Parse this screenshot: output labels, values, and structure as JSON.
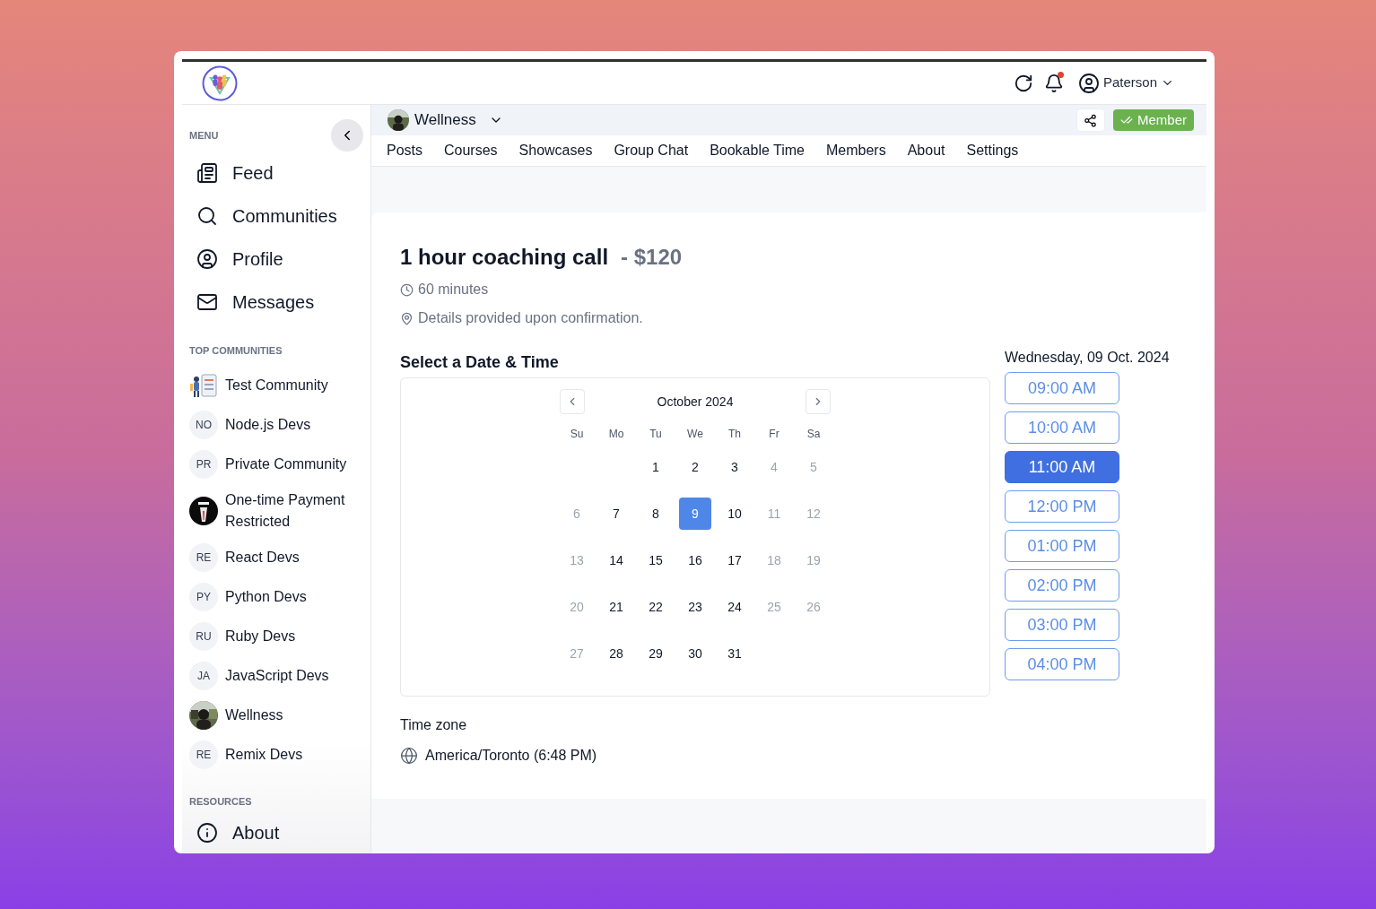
{
  "header": {
    "user": "Paterson",
    "notifications_unread": true
  },
  "sidebar": {
    "menu_label": "MENU",
    "menu": [
      {
        "label": "Feed",
        "kind": "feed"
      },
      {
        "label": "Communities",
        "kind": "search"
      },
      {
        "label": "Profile",
        "kind": "profile"
      },
      {
        "label": "Messages",
        "kind": "mail"
      }
    ],
    "communities_label": "TOP COMMUNITIES",
    "communities": [
      {
        "name": "Test Community",
        "kind": "picture"
      },
      {
        "name": "Node.js Devs",
        "initials": "NO",
        "kind": "initials"
      },
      {
        "name": "Private Community",
        "initials": "PR",
        "kind": "initials"
      },
      {
        "name": "One-time Payment Restricted",
        "kind": "picture"
      },
      {
        "name": "React Devs",
        "initials": "RE",
        "kind": "initials"
      },
      {
        "name": "Python Devs",
        "initials": "PY",
        "kind": "initials"
      },
      {
        "name": "Ruby Devs",
        "initials": "RU",
        "kind": "initials"
      },
      {
        "name": "JavaScript Devs",
        "initials": "JA",
        "kind": "initials"
      },
      {
        "name": "Wellness",
        "kind": "picture"
      },
      {
        "name": "Remix Devs",
        "initials": "RE",
        "kind": "initials"
      }
    ],
    "resources_label": "RESOURCES",
    "resources": [
      {
        "label": "About"
      }
    ]
  },
  "community": {
    "name": "Wellness",
    "member_label": "Member"
  },
  "tabs": [
    "Posts",
    "Courses",
    "Showcases",
    "Group Chat",
    "Bookable Time",
    "Members",
    "About",
    "Settings"
  ],
  "booking": {
    "title": "1 hour coaching call",
    "price": "- $120",
    "duration": "60 minutes",
    "location": "Details provided upon confirmation.",
    "select_heading": "Select a Date & Time",
    "calendar": {
      "month": "October 2024",
      "weekdays": [
        "Su",
        "Mo",
        "Tu",
        "We",
        "Th",
        "Fr",
        "Sa"
      ],
      "weeks": [
        [
          {
            "day": "1",
            "disabled": false,
            "selected": false
          },
          {
            "day": "2",
            "disabled": false,
            "selected": false
          },
          {
            "day": "3",
            "disabled": false,
            "selected": false
          },
          {
            "day": "4",
            "disabled": true,
            "selected": false
          },
          {
            "day": "5",
            "disabled": true,
            "selected": false
          }
        ],
        [
          {
            "day": "6",
            "disabled": true,
            "selected": false
          },
          {
            "day": "7",
            "disabled": false,
            "selected": false
          },
          {
            "day": "8",
            "disabled": false,
            "selected": false
          },
          {
            "day": "9",
            "disabled": false,
            "selected": true
          },
          {
            "day": "10",
            "disabled": false,
            "selected": false
          },
          {
            "day": "11",
            "disabled": true,
            "selected": false
          },
          {
            "day": "12",
            "disabled": true,
            "selected": false
          }
        ],
        [
          {
            "day": "13",
            "disabled": true,
            "selected": false
          },
          {
            "day": "14",
            "disabled": false,
            "selected": false
          },
          {
            "day": "15",
            "disabled": false,
            "selected": false
          },
          {
            "day": "16",
            "disabled": false,
            "selected": false
          },
          {
            "day": "17",
            "disabled": false,
            "selected": false
          },
          {
            "day": "18",
            "disabled": true,
            "selected": false
          },
          {
            "day": "19",
            "disabled": true,
            "selected": false
          }
        ],
        [
          {
            "day": "20",
            "disabled": true,
            "selected": false
          },
          {
            "day": "21",
            "disabled": false,
            "selected": false
          },
          {
            "day": "22",
            "disabled": false,
            "selected": false
          },
          {
            "day": "23",
            "disabled": false,
            "selected": false
          },
          {
            "day": "24",
            "disabled": false,
            "selected": false
          },
          {
            "day": "25",
            "disabled": true,
            "selected": false
          },
          {
            "day": "26",
            "disabled": true,
            "selected": false
          }
        ],
        [
          {
            "day": "27",
            "disabled": true,
            "selected": false
          },
          {
            "day": "28",
            "disabled": false,
            "selected": false
          },
          {
            "day": "29",
            "disabled": false,
            "selected": false
          },
          {
            "day": "30",
            "disabled": false,
            "selected": false
          },
          {
            "day": "31",
            "disabled": false,
            "selected": false
          }
        ]
      ]
    },
    "date_heading": "Wednesday, 09 Oct. 2024",
    "slots": [
      {
        "time": "09:00 AM",
        "selected": false
      },
      {
        "time": "10:00 AM",
        "selected": false
      },
      {
        "time": "11:00 AM",
        "selected": true
      },
      {
        "time": "12:00 PM",
        "selected": false
      },
      {
        "time": "01:00 PM",
        "selected": false
      },
      {
        "time": "02:00 PM",
        "selected": false
      },
      {
        "time": "03:00 PM",
        "selected": false
      },
      {
        "time": "04:00 PM",
        "selected": false
      }
    ],
    "timezone_label": "Time zone",
    "timezone": "America/Toronto (6:48 PM)"
  }
}
